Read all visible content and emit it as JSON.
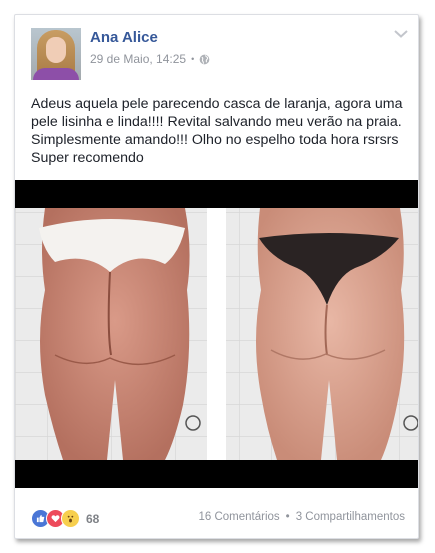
{
  "post": {
    "author": "Ana Alice",
    "timestamp": "29 de Maio, 14:25",
    "separator": "•",
    "privacy_icon": "globe-icon",
    "menu_icon": "chevron-down-icon",
    "text": "Adeus aquela pele parecendo casca de laranja, agora uma pele lisinha e linda!!!!  Revital salvando meu verão na praia. Simplesmente amando!!! Olho no espelho toda hora rsrsrs Super recomendo"
  },
  "footer": {
    "reaction_icons": [
      "like-icon",
      "love-icon",
      "wow-icon"
    ],
    "reaction_count": "68",
    "comments": "16 Comentários",
    "separator": "•",
    "shares": "3 Compartilhamentos"
  },
  "colors": {
    "author_link": "#365899",
    "meta_gray": "#90949c",
    "like_blue": "#4a76d6",
    "love_red": "#ed4a5b",
    "wow_yellow": "#f7cf4e"
  }
}
